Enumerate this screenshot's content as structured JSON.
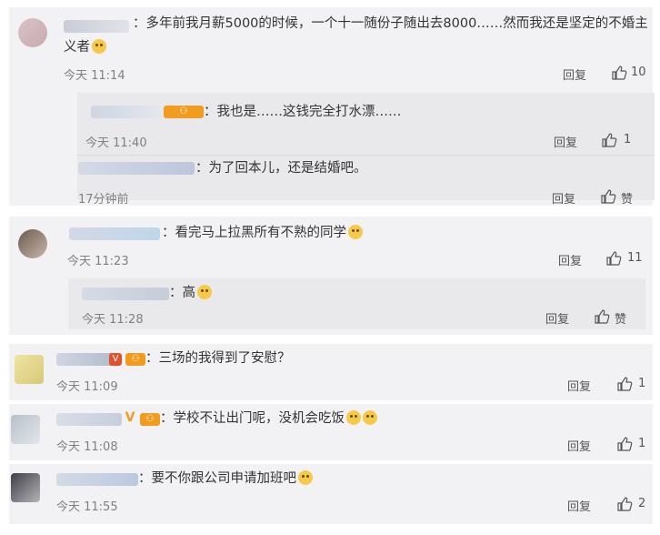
{
  "comments": [
    {
      "text": "：多年前我月薪5000的时候，一个十一随份子随出去8000……然而我还是坚定的不婚主",
      "text2": "义者",
      "time": "今天 11:14",
      "reply_label": "回复",
      "likes": "10",
      "replies": [
        {
          "text": "：我也是……这钱完全打水漂……",
          "time": "今天 11:40",
          "reply_label": "回复",
          "likes": "1"
        },
        {
          "text": "：为了回本儿，还是结婚吧。",
          "time": "17分钟前",
          "reply_label": "回复",
          "likes": "赞"
        }
      ]
    },
    {
      "text": "：看完马上拉黑所有不熟的同学",
      "time": "今天 11:23",
      "reply_label": "回复",
      "likes": "11",
      "replies": [
        {
          "text": "：高",
          "time": "今天 11:28",
          "reply_label": "回复",
          "likes": "赞"
        }
      ]
    },
    {
      "text": "：三场的我得到了安慰？",
      "time": "今天 11:09",
      "reply_label": "回复",
      "likes": "1"
    },
    {
      "text": "：学校不让出门呢，没机会吃饭",
      "time": "今天 11:08",
      "reply_label": "回复",
      "likes": "1"
    },
    {
      "text": "：要不你跟公司申请加班吧",
      "time": "今天 11:55",
      "reply_label": "回复",
      "likes": "2"
    }
  ],
  "colors": {
    "card_bg": "#f2f2f5",
    "reply_bg": "#e9e9ec",
    "badge_orange": "#f29c1f",
    "badge_red": "#e0522e"
  },
  "icons": [
    "like-thumb-icon",
    "emoji-smile-icon",
    "verified-v-icon",
    "fan-badge-icon"
  ]
}
